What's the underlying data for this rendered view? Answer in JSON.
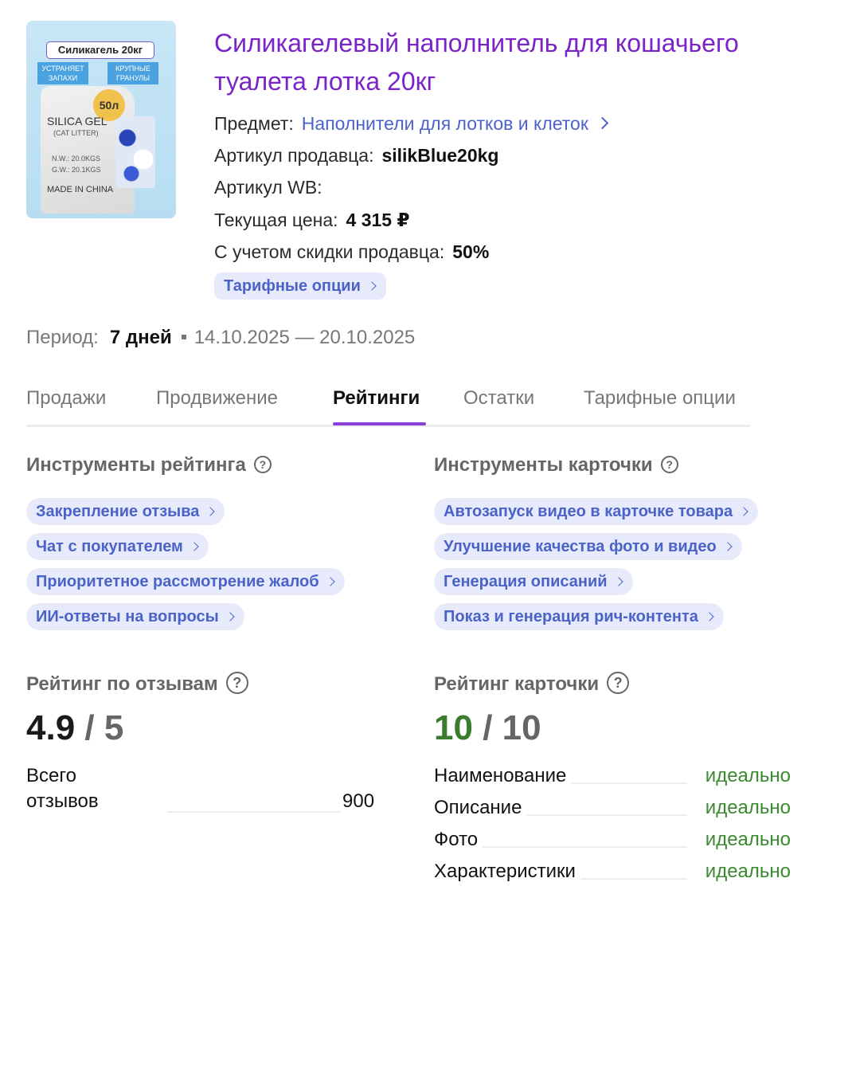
{
  "product": {
    "title": "Силикагелевый наполнитель для кошачьего туалета лотка 20кг",
    "image": {
      "label": "Силикагель 20кг",
      "chip_left": "УСТРАНЯЕТ ЗАПАХИ",
      "chip_right": "КРУПНЫЕ ГРАНУЛЫ",
      "badge": "50л",
      "bag_title": "SILICA GEL",
      "bag_sub": "(CAT LITTER)",
      "bag_nw": "N.W.: 20.0KGS",
      "bag_gw": "G.W.: 20.1KGS",
      "bag_origin": "MADE IN CHINA"
    },
    "subject_label": "Предмет:",
    "subject_value": "Наполнители для лотков и клеток",
    "seller_article_label": "Артикул продавца:",
    "seller_article_value": "silikBlue20kg",
    "wb_article_label": "Артикул WB:",
    "price_label": "Текущая цена:",
    "price_value": "4 315 ₽",
    "discount_label": "С учетом скидки продавца:",
    "discount_value": "50%",
    "tariff_button": "Тарифные опции"
  },
  "period": {
    "label": "Период:",
    "days": "7 дней",
    "range": "14.10.2025 — 20.10.2025"
  },
  "tabs": [
    {
      "label": "Продажи",
      "active": false
    },
    {
      "label": "Продвижение",
      "active": false
    },
    {
      "label": "Рейтинги",
      "active": true
    },
    {
      "label": "Остатки",
      "active": false
    },
    {
      "label": "Тарифные опции",
      "active": false
    }
  ],
  "rating_tools": {
    "title": "Инструменты рейтинга",
    "items": [
      "Закрепление отзыва",
      "Чат с покупателем",
      "Приоритетное рассмотрение жалоб",
      "ИИ-ответы на вопросы"
    ]
  },
  "card_tools": {
    "title": "Инструменты карточки",
    "items": [
      "Автозапуск видео в карточке товара",
      "Улучшение качества фото и видео",
      "Генерация описаний",
      "Показ и генерация рич-контента"
    ]
  },
  "review_rating": {
    "title": "Рейтинг по отзывам",
    "value": "4.9",
    "slash": "/",
    "max": "5",
    "total_label": "Всего отзывов",
    "total_value": "900"
  },
  "card_rating": {
    "title": "Рейтинг карточки",
    "value": "10",
    "slash": "/",
    "max": "10",
    "value_color": "#3a7d2c",
    "criteria": [
      {
        "name": "Наименование",
        "status": "идеально"
      },
      {
        "name": "Описание",
        "status": "идеально"
      },
      {
        "name": "Фото",
        "status": "идеально"
      },
      {
        "name": "Характеристики",
        "status": "идеально"
      }
    ]
  },
  "colors": {
    "title_purple": "#7a23c9",
    "link_blue": "#4b63c8",
    "pill_bg": "#e6eafb",
    "tab_underline": "#8b3fd6",
    "status_green": "#3a8a2f"
  },
  "icons": {
    "help": "question-circle-icon",
    "chevron": "chevron-right-icon"
  }
}
